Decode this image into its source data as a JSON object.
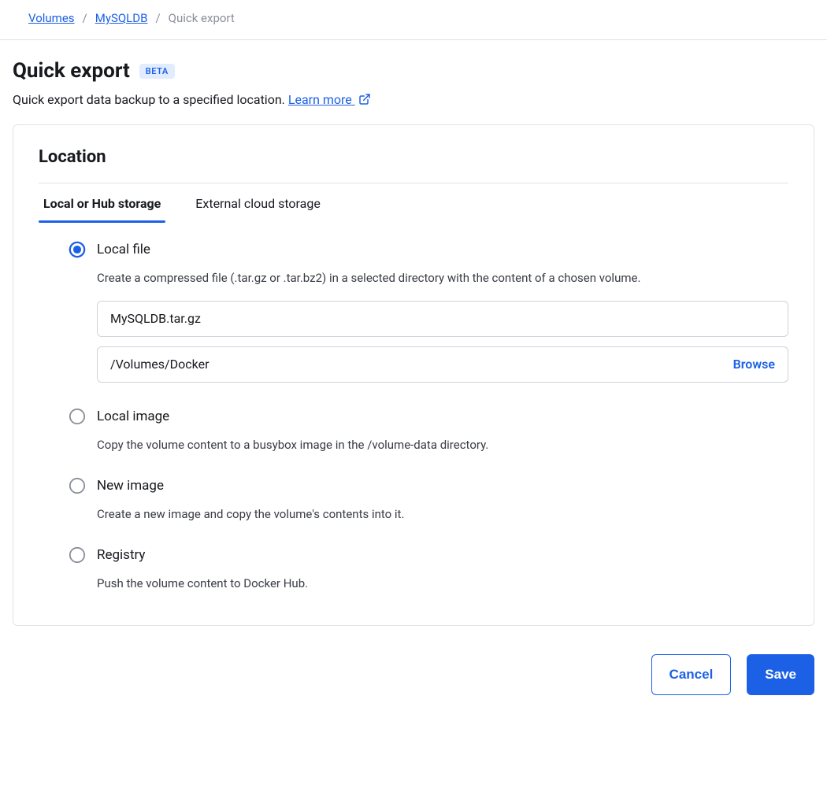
{
  "breadcrumb": {
    "volumes": "Volumes",
    "db": "MySQLDB",
    "current": "Quick export"
  },
  "header": {
    "title": "Quick export",
    "badge": "BETA",
    "subtitle_prefix": "Quick export data backup to a specified location. ",
    "learn_more": "Learn more"
  },
  "card": {
    "location_title": "Location",
    "tabs": {
      "local": "Local or Hub storage",
      "external": "External cloud storage"
    },
    "options": {
      "local_file": {
        "label": "Local file",
        "desc": "Create a compressed file (.tar.gz or .tar.bz2) in a selected directory with the content of a chosen volume.",
        "filename": "MySQLDB.tar.gz",
        "path": "/Volumes/Docker",
        "browse": "Browse"
      },
      "local_image": {
        "label": "Local image",
        "desc": "Copy the volume content to a busybox image in the /volume-data directory."
      },
      "new_image": {
        "label": "New image",
        "desc": "Create a new image and copy the volume's contents into it."
      },
      "registry": {
        "label": "Registry",
        "desc": "Push the volume content to Docker Hub."
      }
    }
  },
  "footer": {
    "cancel": "Cancel",
    "save": "Save"
  }
}
